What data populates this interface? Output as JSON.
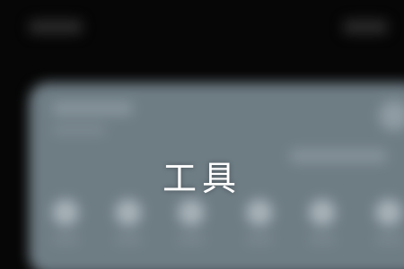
{
  "overlay": {
    "label": "工具"
  },
  "colors": {
    "background": "#060606",
    "card": "#6e7c84",
    "label_text": "#ffffff"
  },
  "tool_slots": [
    {
      "icon": "tool-slot-icon"
    },
    {
      "icon": "tool-slot-icon"
    },
    {
      "icon": "tool-slot-icon"
    },
    {
      "icon": "tool-slot-icon"
    },
    {
      "icon": "tool-slot-icon"
    },
    {
      "icon": "tool-slot-icon"
    }
  ]
}
